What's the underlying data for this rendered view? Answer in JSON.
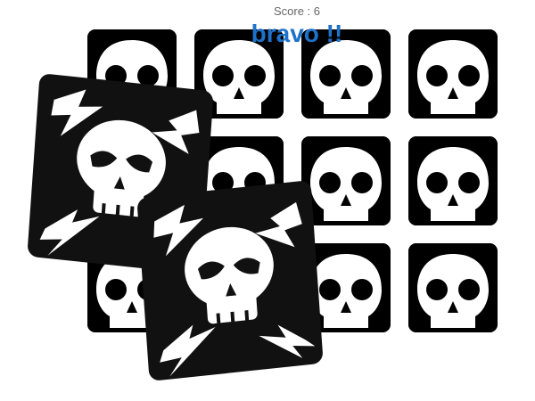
{
  "hud": {
    "score_label": "Score : 6",
    "message": "bravo !!"
  },
  "board": {
    "rows": 3,
    "cols": 4,
    "card_icon": "skull-icon",
    "back_icon": "skull-lightning-icon",
    "tiles": [
      {
        "row": 0,
        "col": 0,
        "icon": "skull-icon"
      },
      {
        "row": 0,
        "col": 1,
        "icon": "skull-icon"
      },
      {
        "row": 0,
        "col": 2,
        "icon": "skull-icon"
      },
      {
        "row": 0,
        "col": 3,
        "icon": "skull-icon"
      },
      {
        "row": 1,
        "col": 0,
        "icon": "skull-icon"
      },
      {
        "row": 1,
        "col": 1,
        "icon": "skull-icon"
      },
      {
        "row": 1,
        "col": 2,
        "icon": "skull-icon"
      },
      {
        "row": 1,
        "col": 3,
        "icon": "skull-icon"
      },
      {
        "row": 2,
        "col": 0,
        "icon": "skull-icon"
      },
      {
        "row": 2,
        "col": 1,
        "icon": "skull-icon"
      },
      {
        "row": 2,
        "col": 2,
        "icon": "skull-icon"
      },
      {
        "row": 2,
        "col": 3,
        "icon": "skull-icon"
      }
    ]
  },
  "colors": {
    "message": "#1e72c9",
    "card": "#000000",
    "icon": "#ffffff"
  }
}
